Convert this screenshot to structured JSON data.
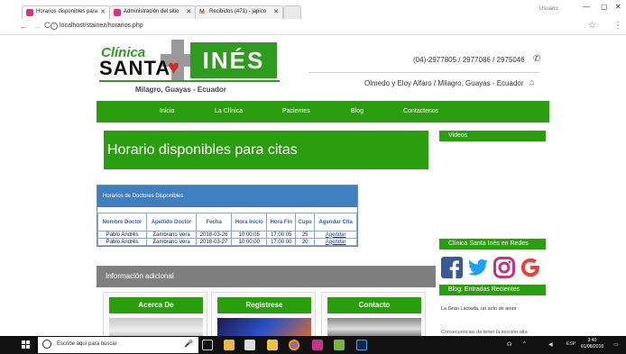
{
  "browser": {
    "tabs": [
      {
        "label": "Horarios disponibles para",
        "color": "#e0307f"
      },
      {
        "label": "Administración del sitio",
        "color": "#e0307f"
      },
      {
        "label": "Recibidos (471) - japico",
        "color": "#ffffff"
      }
    ],
    "user": "Usuario",
    "url": "localhost/stainez/horarios.php"
  },
  "header": {
    "logo_top": "Clínica",
    "logo_left": "SANTA",
    "logo_right": "INÉS",
    "logo_sub": "Milagro, Guayas - Ecuador",
    "phone": "(04)-2977805 / 2977086 / 2975046",
    "address": "Olmedo y Eloy Alfaro / Milagro, Guayas - Ecuador"
  },
  "nav": [
    "Inicio",
    "La Clínica",
    "Pacientes",
    "Blog",
    "Contactenos"
  ],
  "main": {
    "title": "Horario disponibles para citas",
    "table_title": "Horarios de Doctores Disponibles",
    "columns": [
      "Nombre Doctor",
      "Apellido Doctor",
      "Fecha",
      "Hora Inicio",
      "Hora Fin",
      "Cupo",
      "Agendar Cita"
    ],
    "rows": [
      [
        "Pablo Andrés",
        "Zambrano Vera",
        "2018-03-26",
        "10:00:05",
        "17:00:05",
        "25",
        "Agendar"
      ],
      [
        "Pablo Andrés",
        "Zambrano Vera",
        "2018-03-27",
        "10:00:00",
        "17:00:00",
        "20",
        "Agendar"
      ]
    ],
    "info_label": "Información adicional",
    "cards": [
      "Acerca De",
      "Registrese",
      "Contacto"
    ]
  },
  "sidebar": {
    "videos": "Videos",
    "social": "Clínica Santa Inés en Redes",
    "blog": "Blog: Entradas Recientes",
    "blog_entry": "La Gran Lactada, un acto de amor",
    "blog_entry2": "Consecuencias de tener la sección alta"
  },
  "taskbar": {
    "search": "Escribe aquí para buscar",
    "lang": "ESP",
    "time": "3:40",
    "date": "01/08/2018"
  },
  "colors": {
    "green": "#2a9e0e",
    "blue": "#3f7fc0",
    "gray": "#7f7f7f"
  }
}
